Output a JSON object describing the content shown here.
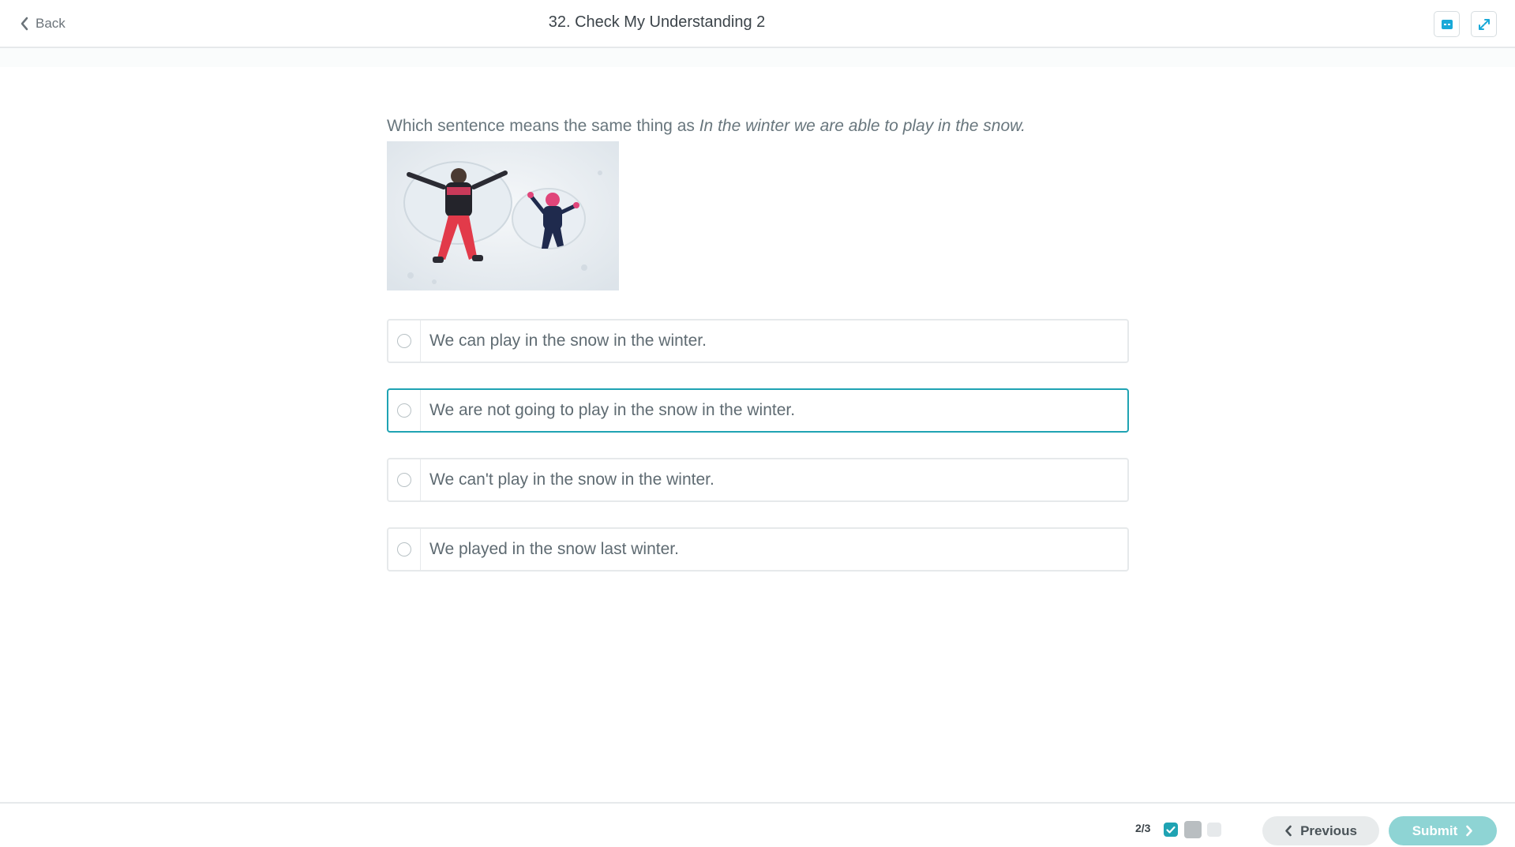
{
  "header": {
    "back_label": "Back",
    "title": "32. Check My Understanding 2"
  },
  "question": {
    "prefix": "Which sentence means the same thing as ",
    "quote": "In the winter we are able to play in the snow."
  },
  "options": [
    {
      "label": "We can play in the snow in the winter.",
      "selected": false
    },
    {
      "label": "We are not going to play in the snow in the winter.",
      "selected": true
    },
    {
      "label": "We can't play in the snow in the winter.",
      "selected": false
    },
    {
      "label": "We played in the snow last winter.",
      "selected": false
    }
  ],
  "footer": {
    "page_count": "2/3",
    "previous_label": "Previous",
    "submit_label": "Submit"
  },
  "colors": {
    "accent": "#1fa3b3",
    "submit_bg": "#8ed4d4",
    "previous_bg": "#e8ebec"
  },
  "icons": {
    "back": "chevron-left-icon",
    "tool": "highlighter-icon",
    "expand": "expand-icon",
    "previous": "chevron-left-icon",
    "submit": "chevron-right-icon",
    "progress_done": "check-icon"
  }
}
